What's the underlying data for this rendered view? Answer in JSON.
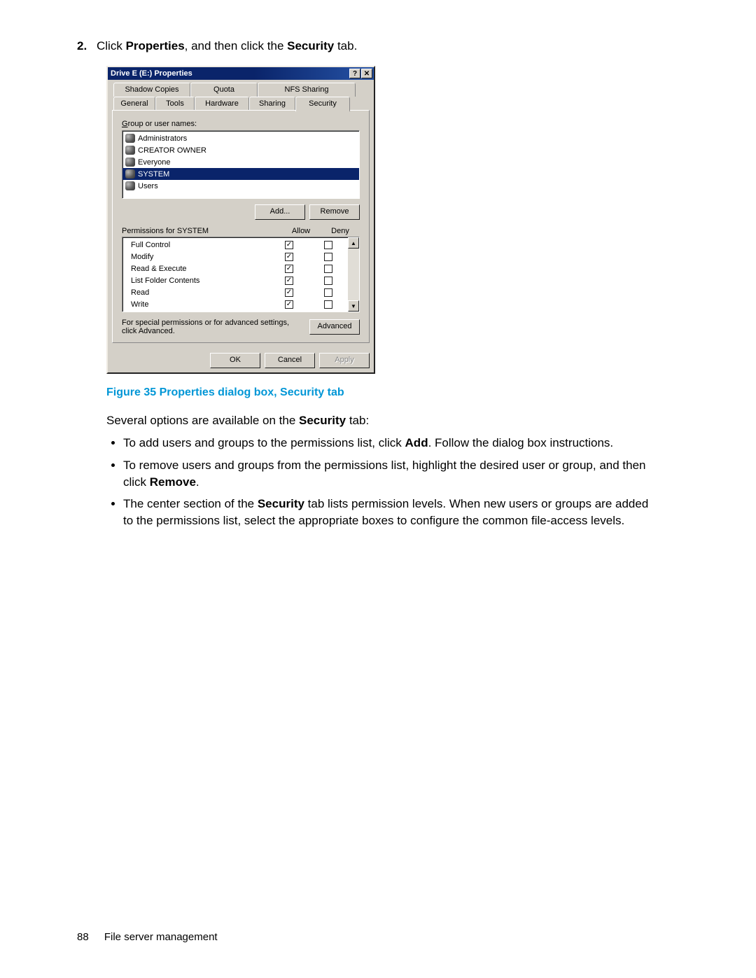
{
  "step": {
    "number": "2.",
    "pre": "Click ",
    "b1": "Properties",
    "mid": ", and then click the ",
    "b2": "Security",
    "post": " tab."
  },
  "dialog": {
    "title": "Drive E (E:) Properties",
    "tabs_back": [
      "Shadow Copies",
      "Quota",
      "NFS Sharing"
    ],
    "tabs_front": [
      "General",
      "Tools",
      "Hardware",
      "Sharing",
      "Security"
    ],
    "group_label": "Group or user names:",
    "groups": [
      "Administrators",
      "CREATOR OWNER",
      "Everyone",
      "SYSTEM",
      "Users"
    ],
    "selected_group": "SYSTEM",
    "add_btn": "Add...",
    "remove_btn": "Remove",
    "perm_label": "Permissions for SYSTEM",
    "allow_hdr": "Allow",
    "deny_hdr": "Deny",
    "permissions": [
      {
        "name": "Full Control",
        "allow": true,
        "deny": false
      },
      {
        "name": "Modify",
        "allow": true,
        "deny": false
      },
      {
        "name": "Read & Execute",
        "allow": true,
        "deny": false
      },
      {
        "name": "List Folder Contents",
        "allow": true,
        "deny": false
      },
      {
        "name": "Read",
        "allow": true,
        "deny": false
      },
      {
        "name": "Write",
        "allow": true,
        "deny": false
      }
    ],
    "adv_text": "For special permissions or for advanced settings, click Advanced.",
    "adv_btn": "Advanced",
    "ok_btn": "OK",
    "cancel_btn": "Cancel",
    "apply_btn": "Apply"
  },
  "caption": "Figure 35 Properties dialog box, Security tab",
  "intro": {
    "pre": "Several options are available on the ",
    "b": "Security",
    "post": " tab:"
  },
  "bullets": {
    "b1": {
      "pre": "To add users and groups to the permissions list, click ",
      "b": "Add",
      "post": ". Follow the dialog box instructions."
    },
    "b2": {
      "pre": "To remove users and groups from the permissions list, highlight the desired user or group, and then click ",
      "b": "Remove",
      "post": "."
    },
    "b3": {
      "pre": "The center section of the ",
      "b": "Security",
      "post": " tab lists permission levels. When new users or groups are added to the permissions list, select the appropriate boxes to configure the common file-access levels."
    }
  },
  "footer": {
    "page": "88",
    "section": "File server management"
  }
}
